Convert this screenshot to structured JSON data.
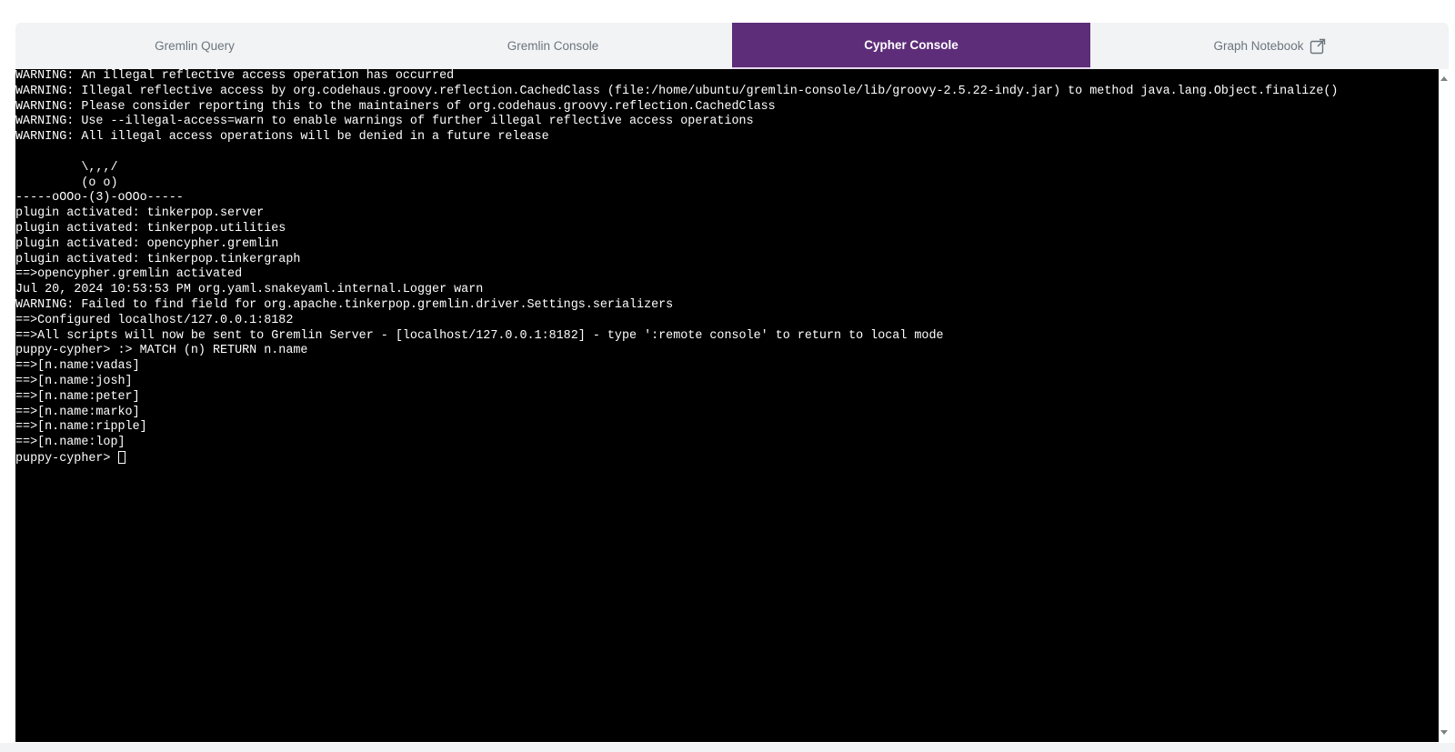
{
  "tabs": [
    {
      "label": "Gremlin Query"
    },
    {
      "label": "Gremlin Console"
    },
    {
      "label": "Cypher Console"
    },
    {
      "label": "Graph Notebook"
    }
  ],
  "terminal": {
    "lines": [
      "WARNING: An illegal reflective access operation has occurred",
      "WARNING: Illegal reflective access by org.codehaus.groovy.reflection.CachedClass (file:/home/ubuntu/gremlin-console/lib/groovy-2.5.22-indy.jar) to method java.lang.Object.finalize()",
      "WARNING: Please consider reporting this to the maintainers of org.codehaus.groovy.reflection.CachedClass",
      "WARNING: Use --illegal-access=warn to enable warnings of further illegal reflective access operations",
      "WARNING: All illegal access operations will be denied in a future release",
      "",
      "         \\,,,/",
      "         (o o)",
      "-----oOOo-(3)-oOOo-----",
      "plugin activated: tinkerpop.server",
      "plugin activated: tinkerpop.utilities",
      "plugin activated: opencypher.gremlin",
      "plugin activated: tinkerpop.tinkergraph",
      "==>opencypher.gremlin activated",
      "Jul 20, 2024 10:53:53 PM org.yaml.snakeyaml.internal.Logger warn",
      "WARNING: Failed to find field for org.apache.tinkerpop.gremlin.driver.Settings.serializers",
      "==>Configured localhost/127.0.0.1:8182",
      "==>All scripts will now be sent to Gremlin Server - [localhost/127.0.0.1:8182] - type ':remote console' to return to local mode",
      "puppy-cypher> :> MATCH (n) RETURN n.name",
      "==>[n.name:vadas]",
      "==>[n.name:josh]",
      "==>[n.name:peter]",
      "==>[n.name:marko]",
      "==>[n.name:ripple]",
      "==>[n.name:lop]"
    ],
    "prompt": "puppy-cypher> "
  }
}
